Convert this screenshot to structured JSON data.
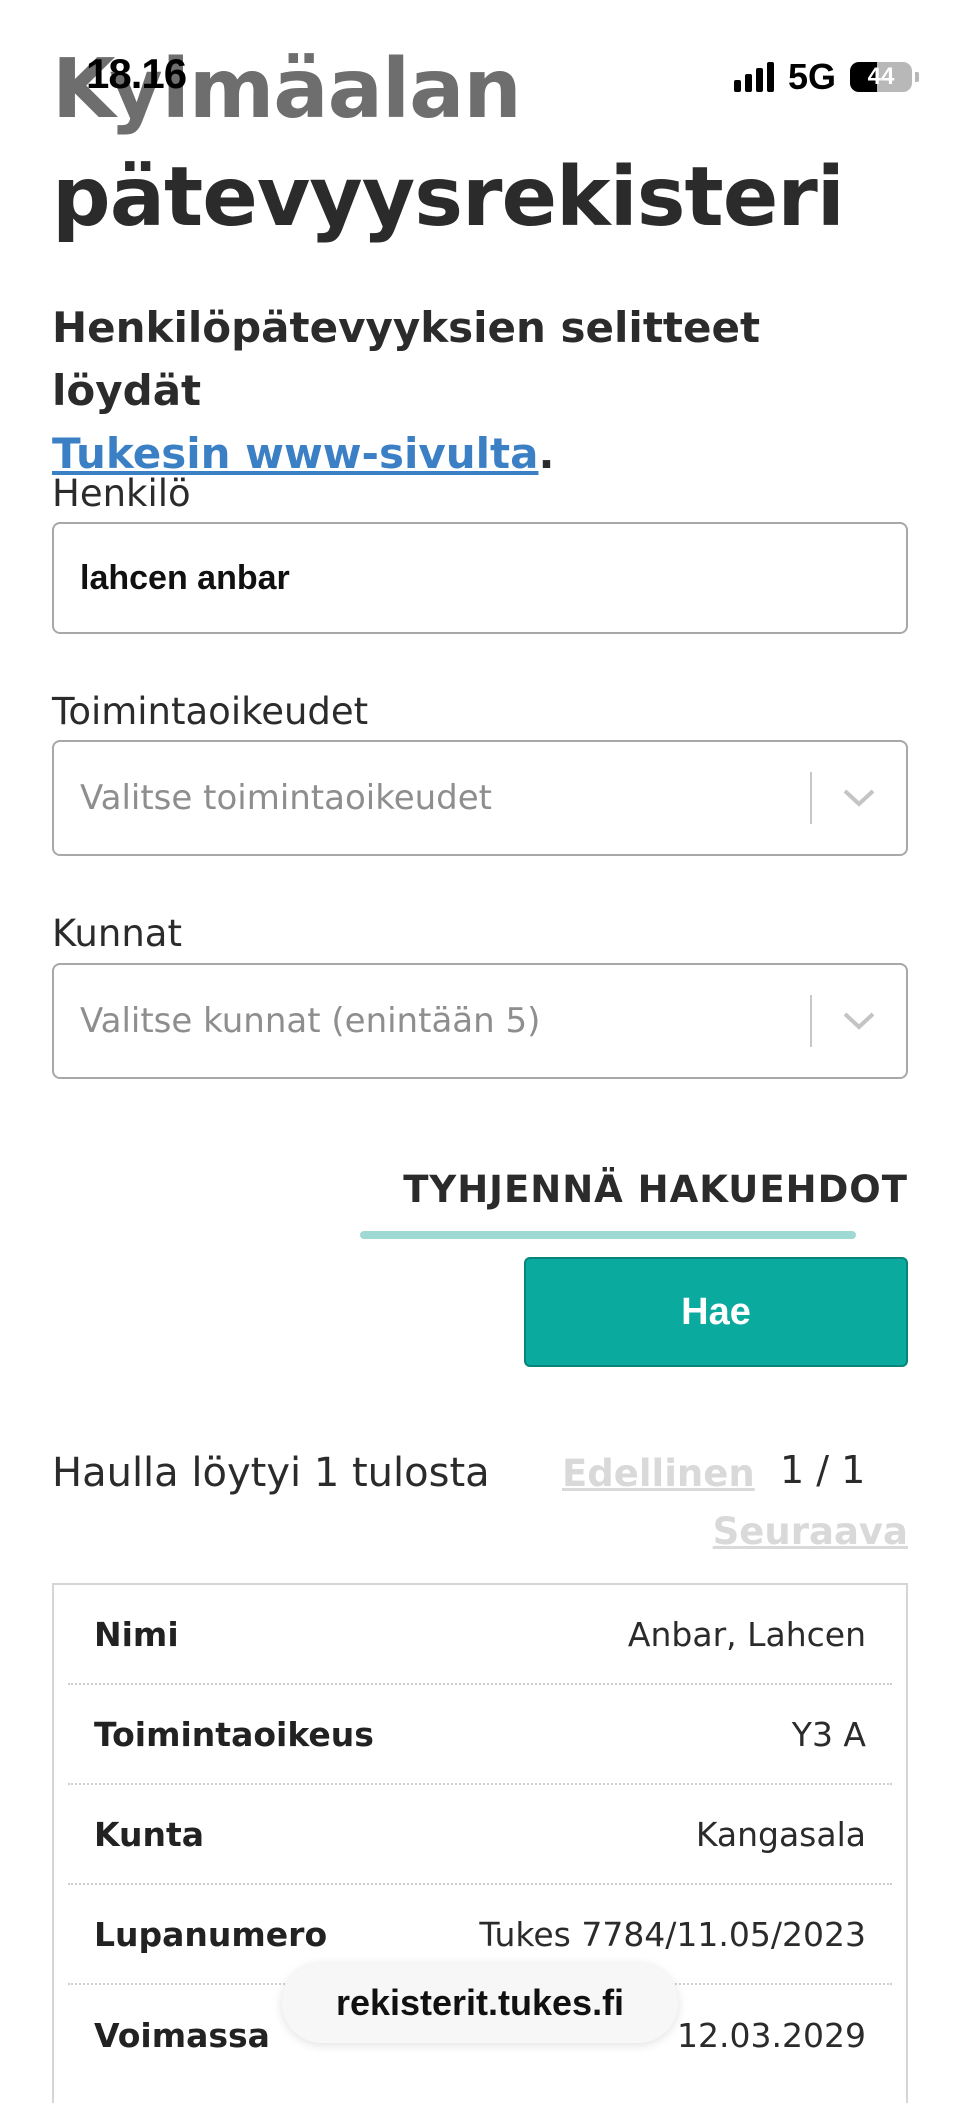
{
  "status_bar": {
    "time": "18.16",
    "network": "5G",
    "battery": "44",
    "battery_level": 0.44
  },
  "header": {
    "title_line1": "Kylmäalan",
    "title_line2": "pätevyysrekisteri",
    "subtitle_text": "Henkilöpätevyyksien selitteet löydät",
    "subtitle_link": "Tukesin www-sivulta",
    "subtitle_end": "."
  },
  "form": {
    "person_label": "Henkilö",
    "person_value": "lahcen anbar",
    "rights_label": "Toimintaoikeudet",
    "rights_placeholder": "Valitse toimintaoikeudet",
    "municipalities_label": "Kunnat",
    "municipalities_placeholder": "Valitse kunnat (enintään 5)",
    "clear_label": "TYHJENNÄ HAKUEHDOT",
    "search_label": "Hae"
  },
  "results": {
    "count_text": "Haulla löytyi 1 tulosta",
    "prev_label": "Edellinen",
    "page_indicator": "1 / 1",
    "next_label": "Seuraava",
    "rows": [
      {
        "key": "Nimi",
        "value": "Anbar, Lahcen"
      },
      {
        "key": "Toimintaoikeus",
        "value": "Y3 A"
      },
      {
        "key": "Kunta",
        "value": "Kangasala"
      },
      {
        "key": "Lupanumero",
        "value": "Tukes 7784/11.05/2023"
      },
      {
        "key": "Voimassa",
        "value": "12.03.2029"
      }
    ]
  },
  "browser": {
    "url": "rekisterit.tukes.fi"
  },
  "colors": {
    "accent": "#0aaa9f",
    "link": "#3b7fc4",
    "underline": "#9fd9d4"
  },
  "icons": {
    "select_arrow": "chevron-down-icon",
    "signal": "signal-icon",
    "battery": "battery-icon"
  }
}
